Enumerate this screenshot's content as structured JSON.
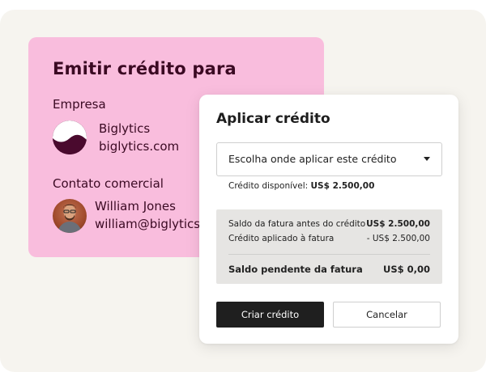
{
  "issue_card": {
    "title": "Emitir crédito para",
    "company_label": "Empresa",
    "company_name": "Biglytics",
    "company_domain": "biglytics.com",
    "contact_label": "Contato comercial",
    "contact_name": "William Jones",
    "contact_email": "william@biglytics.com"
  },
  "apply_card": {
    "title": "Aplicar crédito",
    "select_placeholder": "Escolha onde aplicar este crédito",
    "available_label": "Crédito disponível:",
    "available_value": "US$ 2.500,00",
    "summary": {
      "rows": [
        {
          "label": "Saldo da fatura antes do crédito",
          "value": "US$ 2.500,00"
        },
        {
          "label": "Crédito aplicado à fatura",
          "value": "- US$ 2.500,00"
        }
      ],
      "total_label": "Saldo pendente da fatura",
      "total_value": "US$ 0,00"
    },
    "primary_button": "Criar crédito",
    "secondary_button": "Cancelar"
  },
  "icons": {
    "company_logo": "biglytics-logo-icon",
    "contact_avatar": "avatar",
    "select_caret": "caret-down-icon"
  },
  "colors": {
    "issue_card_bg": "#f9bddd",
    "issue_card_text": "#3b0a23",
    "primary_button_bg": "#1f1f1f",
    "summary_bg": "#e6e5e3"
  }
}
